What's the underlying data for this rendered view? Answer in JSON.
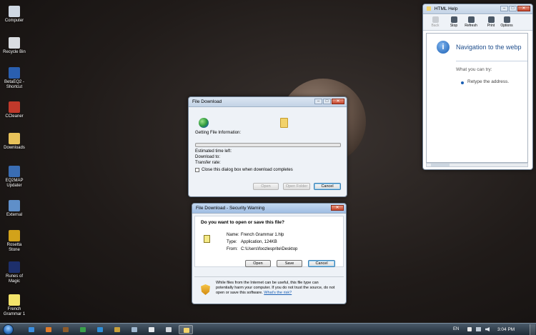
{
  "desktop": {
    "icons": [
      {
        "label": "Computer",
        "icon": "computer-icon",
        "color": "#cfd8e3"
      },
      {
        "label": "Recycle Bin",
        "icon": "recycle-bin-icon",
        "color": "#d9dde2"
      },
      {
        "label": "BetaEQ2 - Shortcut",
        "icon": "betaeq2-icon",
        "color": "#2a5fb0"
      },
      {
        "label": "CCleaner",
        "icon": "ccleaner-icon",
        "color": "#c0392b"
      },
      {
        "label": "Downloads",
        "icon": "downloads-folder-icon",
        "color": "#e8c25a"
      },
      {
        "label": "EQ2MAP Updater",
        "icon": "eq2map-icon",
        "color": "#3a6db3"
      },
      {
        "label": "External",
        "icon": "external-icon",
        "color": "#5f8fc9"
      },
      {
        "label": "Rosetta Stone",
        "icon": "rosetta-stone-icon",
        "color": "#d2a21a"
      },
      {
        "label": "Runes of Magic",
        "icon": "runes-of-magic-icon",
        "color": "#1d2f6b"
      },
      {
        "label": "French Grammar 1",
        "icon": "help-file-icon",
        "color": "#f3e36a"
      }
    ]
  },
  "file_download": {
    "title": "File Download",
    "status": "Getting File Information:",
    "progress": 0,
    "estimated": "Estimated time left:",
    "download_to": "Download to:",
    "transfer_rate": "Transfer rate:",
    "checkbox_label": "Close this dialog box when download completes",
    "checkbox_checked": false,
    "open_label": "Open",
    "open_folder_label": "Open Folder",
    "cancel_label": "Cancel"
  },
  "security_warning": {
    "title": "File Download - Security Warning",
    "question": "Do you want to open or save this file?",
    "name_label": "Name:",
    "name_value": "French Grammar 1.hlp",
    "type_label": "Type:",
    "type_value": "Application, 124KB",
    "from_label": "From:",
    "from_value": "C:\\Users\\foozlesprite\\Desktop",
    "open_label": "Open",
    "save_label": "Save",
    "cancel_label": "Cancel",
    "warning_text_1": "While files from the Internet can be useful, this file type can",
    "warning_text_2": "potentially harm your computer. If you do not trust the source, do not",
    "warning_text_3": "open or save this software.",
    "risk_link": "What's the risk?"
  },
  "html_help": {
    "title": "HTML Help",
    "toolbar": [
      "Back",
      "Stop",
      "Refresh",
      "Print",
      "Options"
    ],
    "heading": "Navigation to the webp",
    "try_label": "What you can try:",
    "bullet": "Retype the address."
  },
  "taskbar": {
    "language": "EN",
    "clock": "3:04 PM",
    "accent": "#1f2b36"
  }
}
